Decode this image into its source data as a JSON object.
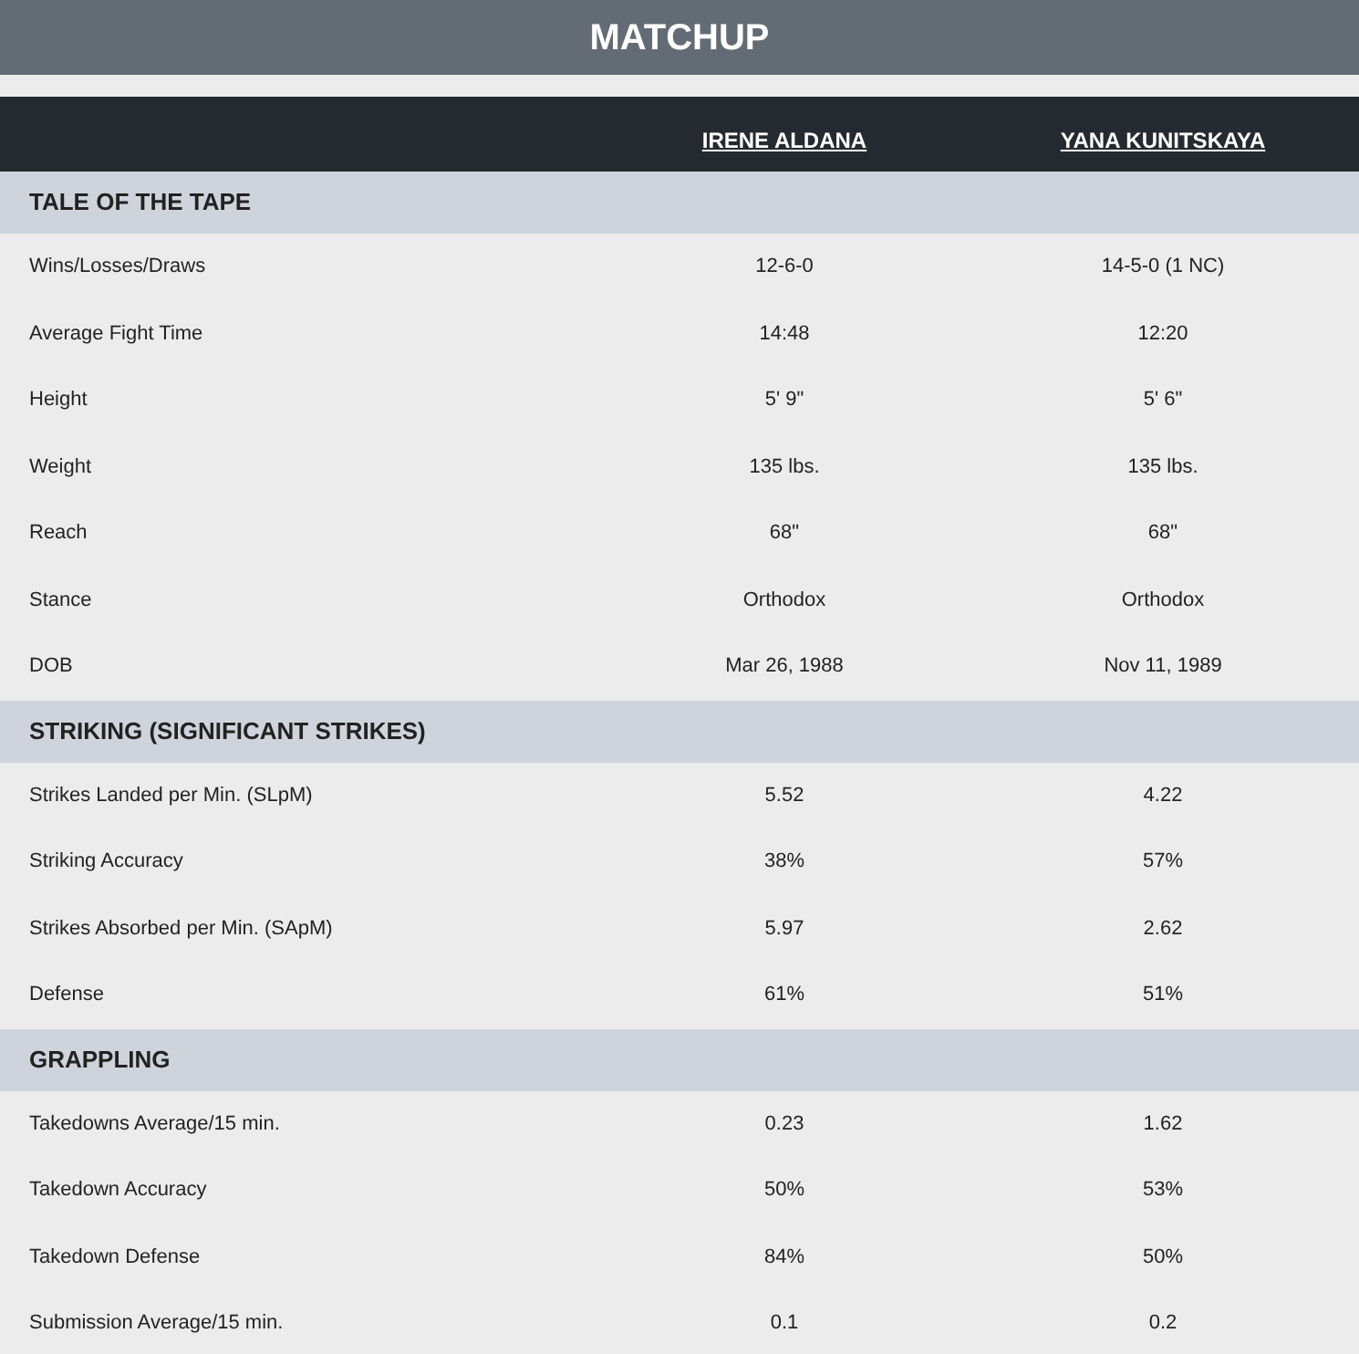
{
  "title": "MATCHUP",
  "fighters": [
    "IRENE ALDANA",
    "YANA KUNITSKAYA"
  ],
  "sections": [
    {
      "title": "TALE OF THE TAPE",
      "rows": [
        {
          "label": "Wins/Losses/Draws",
          "values": [
            "12-6-0",
            "14-5-0 (1 NC)"
          ]
        },
        {
          "label": "Average Fight Time",
          "values": [
            "14:48",
            "12:20"
          ]
        },
        {
          "label": "Height",
          "values": [
            "5' 9\"",
            "5' 6\""
          ]
        },
        {
          "label": "Weight",
          "values": [
            "135 lbs.",
            "135 lbs."
          ]
        },
        {
          "label": "Reach",
          "values": [
            "68\"",
            "68\""
          ]
        },
        {
          "label": "Stance",
          "values": [
            "Orthodox",
            "Orthodox"
          ]
        },
        {
          "label": "DOB",
          "values": [
            "Mar 26, 1988",
            "Nov 11, 1989"
          ]
        }
      ]
    },
    {
      "title": "STRIKING (SIGNIFICANT STRIKES)",
      "rows": [
        {
          "label": "Strikes Landed per Min. (SLpM)",
          "values": [
            "5.52",
            "4.22"
          ]
        },
        {
          "label": "Striking Accuracy",
          "values": [
            "38%",
            "57%"
          ]
        },
        {
          "label": "Strikes Absorbed per Min. (SApM)",
          "values": [
            "5.97",
            "2.62"
          ]
        },
        {
          "label": "Defense",
          "values": [
            "61%",
            "51%"
          ]
        }
      ]
    },
    {
      "title": "GRAPPLING",
      "rows": [
        {
          "label": "Takedowns Average/15 min.",
          "values": [
            "0.23",
            "1.62"
          ]
        },
        {
          "label": "Takedown Accuracy",
          "values": [
            "50%",
            "53%"
          ]
        },
        {
          "label": "Takedown Defense",
          "values": [
            "84%",
            "50%"
          ]
        },
        {
          "label": "Submission Average/15 min.",
          "values": [
            "0.1",
            "0.2"
          ]
        }
      ]
    }
  ]
}
